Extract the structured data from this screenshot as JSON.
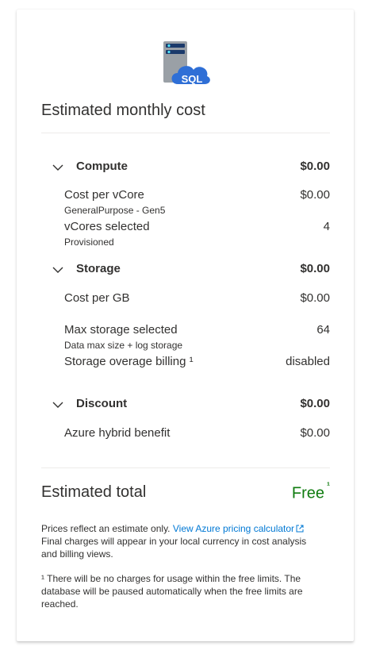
{
  "heading": "Estimated monthly cost",
  "logo": {
    "icon": "sql-database-icon",
    "text": "SQL"
  },
  "sections": {
    "compute": {
      "title": "Compute",
      "amount": "$0.00",
      "items": [
        {
          "label": "Cost per vCore",
          "sub": "GeneralPurpose - Gen5",
          "value": "$0.00"
        },
        {
          "label": "vCores selected",
          "sub": "Provisioned",
          "value": "4"
        }
      ]
    },
    "storage": {
      "title": "Storage",
      "amount": "$0.00",
      "items": [
        {
          "label": "Cost per GB",
          "sub": "",
          "value": "$0.00"
        },
        {
          "label": "Max storage selected",
          "sub": "Data max size + log storage",
          "value": "64"
        },
        {
          "label": "Storage overage billing ¹",
          "sub": "",
          "value": "disabled"
        }
      ]
    },
    "discount": {
      "title": "Discount",
      "amount": "$0.00",
      "items": [
        {
          "label": "Azure hybrid benefit",
          "sub": "",
          "value": "$0.00"
        }
      ]
    }
  },
  "total": {
    "label": "Estimated total",
    "value": "Free",
    "footnote_marker": "¹"
  },
  "notes": {
    "prices_prefix": "Prices reflect an estimate only.",
    "pricing_link": "View Azure pricing calculator",
    "final_charges": "Final charges will appear in your local currency in cost analysis and billing views.",
    "footnote": "¹ There will be no charges for usage within the free limits. The database will be paused automatically when the free limits are reached."
  },
  "colors": {
    "free": "#107c10",
    "link": "#0078d4",
    "logo_blue": "#2f6fd6"
  }
}
